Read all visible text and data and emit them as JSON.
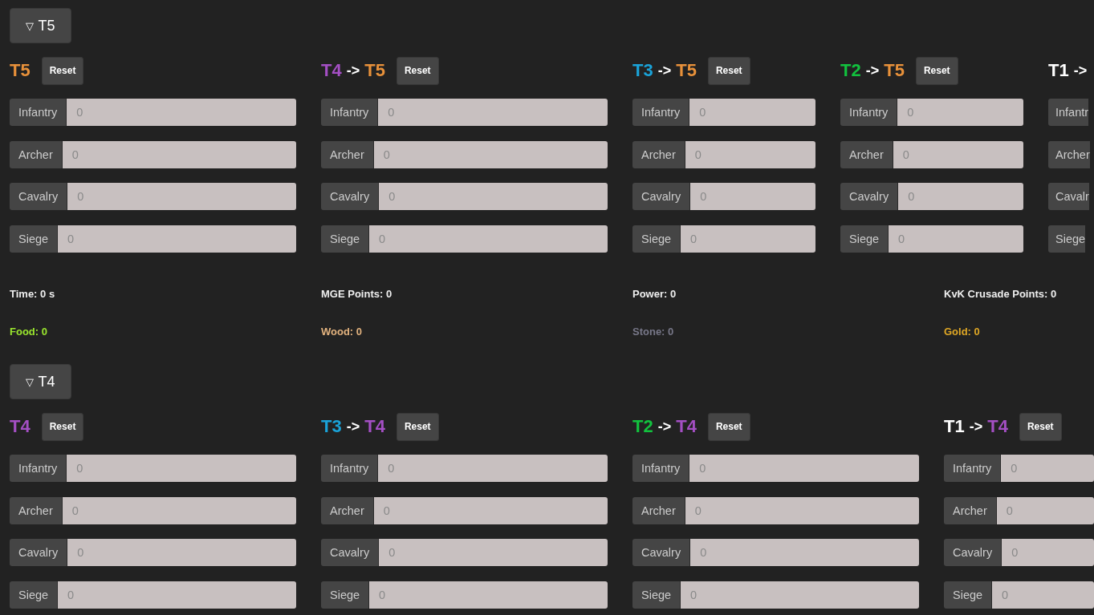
{
  "sections": [
    {
      "toggle": {
        "arrow": "▽",
        "label": "T5",
        "expanded": true
      },
      "columns": [
        {
          "title": [
            {
              "text": "T5",
              "color": "#e8913a"
            }
          ],
          "reset": "Reset",
          "fields": [
            {
              "label": "Infantry",
              "value": "0"
            },
            {
              "label": "Archer",
              "value": "0"
            },
            {
              "label": "Cavalry",
              "value": "0"
            },
            {
              "label": "Siege",
              "value": "0"
            }
          ]
        },
        {
          "title": [
            {
              "text": "T4",
              "color": "#a44fc4"
            },
            {
              "text": "->",
              "color": "#ffffff"
            },
            {
              "text": "T5",
              "color": "#e8913a"
            }
          ],
          "reset": "Reset",
          "fields": [
            {
              "label": "Infantry",
              "value": "0"
            },
            {
              "label": "Archer",
              "value": "0"
            },
            {
              "label": "Cavalry",
              "value": "0"
            },
            {
              "label": "Siege",
              "value": "0"
            }
          ]
        },
        {
          "title": [
            {
              "text": "T3",
              "color": "#1aa3d9"
            },
            {
              "text": "->",
              "color": "#ffffff"
            },
            {
              "text": "T5",
              "color": "#e8913a"
            }
          ],
          "reset": "Reset",
          "fields": [
            {
              "label": "Infantry",
              "value": "0"
            },
            {
              "label": "Archer",
              "value": "0"
            },
            {
              "label": "Cavalry",
              "value": "0"
            },
            {
              "label": "Siege",
              "value": "0"
            }
          ]
        },
        {
          "title": [
            {
              "text": "T2",
              "color": "#12c23e"
            },
            {
              "text": "->",
              "color": "#ffffff"
            },
            {
              "text": "T5",
              "color": "#e8913a"
            }
          ],
          "reset": "Reset",
          "fields": [
            {
              "label": "Infantry",
              "value": "0"
            },
            {
              "label": "Archer",
              "value": "0"
            },
            {
              "label": "Cavalry",
              "value": "0"
            },
            {
              "label": "Siege",
              "value": "0"
            }
          ]
        },
        {
          "title": [
            {
              "text": "T1",
              "color": "#ffffff"
            },
            {
              "text": "->",
              "color": "#ffffff"
            }
          ],
          "fields": [
            {
              "label": "Infantr"
            },
            {
              "label": "Archer"
            },
            {
              "label": "Cavalr"
            },
            {
              "label": "Siege"
            }
          ]
        }
      ],
      "stats": [
        {
          "text": "Time: 0 s",
          "color": "#eeeeee"
        },
        {
          "text": "MGE Points: 0",
          "color": "#eeeeee"
        },
        {
          "text": "Power: 0",
          "color": "#eeeeee"
        },
        {
          "text": "KvK Crusade Points: 0",
          "color": "#eeeeee"
        },
        {
          "text": "Food: 0",
          "color": "#9ae62e"
        },
        {
          "text": "Wood: 0",
          "color": "#e2b27e"
        },
        {
          "text": "Stone: 0",
          "color": "#777788"
        },
        {
          "text": "Gold: 0",
          "color": "#e0a825"
        }
      ]
    },
    {
      "toggle": {
        "arrow": "▽",
        "label": "T4",
        "expanded": true
      },
      "columns": [
        {
          "title": [
            {
              "text": "T4",
              "color": "#a44fc4"
            }
          ],
          "reset": "Reset",
          "fields": [
            {
              "label": "Infantry",
              "value": "0"
            },
            {
              "label": "Archer",
              "value": "0"
            },
            {
              "label": "Cavalry",
              "value": "0"
            },
            {
              "label": "Siege",
              "value": "0"
            }
          ]
        },
        {
          "title": [
            {
              "text": "T3",
              "color": "#1aa3d9"
            },
            {
              "text": "->",
              "color": "#ffffff"
            },
            {
              "text": "T4",
              "color": "#a44fc4"
            }
          ],
          "reset": "Reset",
          "fields": [
            {
              "label": "Infantry",
              "value": "0"
            },
            {
              "label": "Archer",
              "value": "0"
            },
            {
              "label": "Cavalry",
              "value": "0"
            },
            {
              "label": "Siege",
              "value": "0"
            }
          ]
        },
        {
          "title": [
            {
              "text": "T2",
              "color": "#12c23e"
            },
            {
              "text": "->",
              "color": "#ffffff"
            },
            {
              "text": "T4",
              "color": "#a44fc4"
            }
          ],
          "reset": "Reset",
          "fields": [
            {
              "label": "Infantry",
              "value": "0"
            },
            {
              "label": "Archer",
              "value": "0"
            },
            {
              "label": "Cavalry",
              "value": "0"
            },
            {
              "label": "Siege",
              "value": "0"
            }
          ]
        },
        {
          "title": [
            {
              "text": "T1",
              "color": "#ffffff"
            },
            {
              "text": "->",
              "color": "#ffffff"
            },
            {
              "text": "T4",
              "color": "#a44fc4"
            }
          ],
          "reset": "Reset",
          "fields": [
            {
              "label": "Infantry",
              "value": "0"
            },
            {
              "label": "Archer",
              "value": "0"
            },
            {
              "label": "Cavalry",
              "value": "0"
            },
            {
              "label": "Siege",
              "value": "0"
            }
          ]
        }
      ]
    }
  ]
}
